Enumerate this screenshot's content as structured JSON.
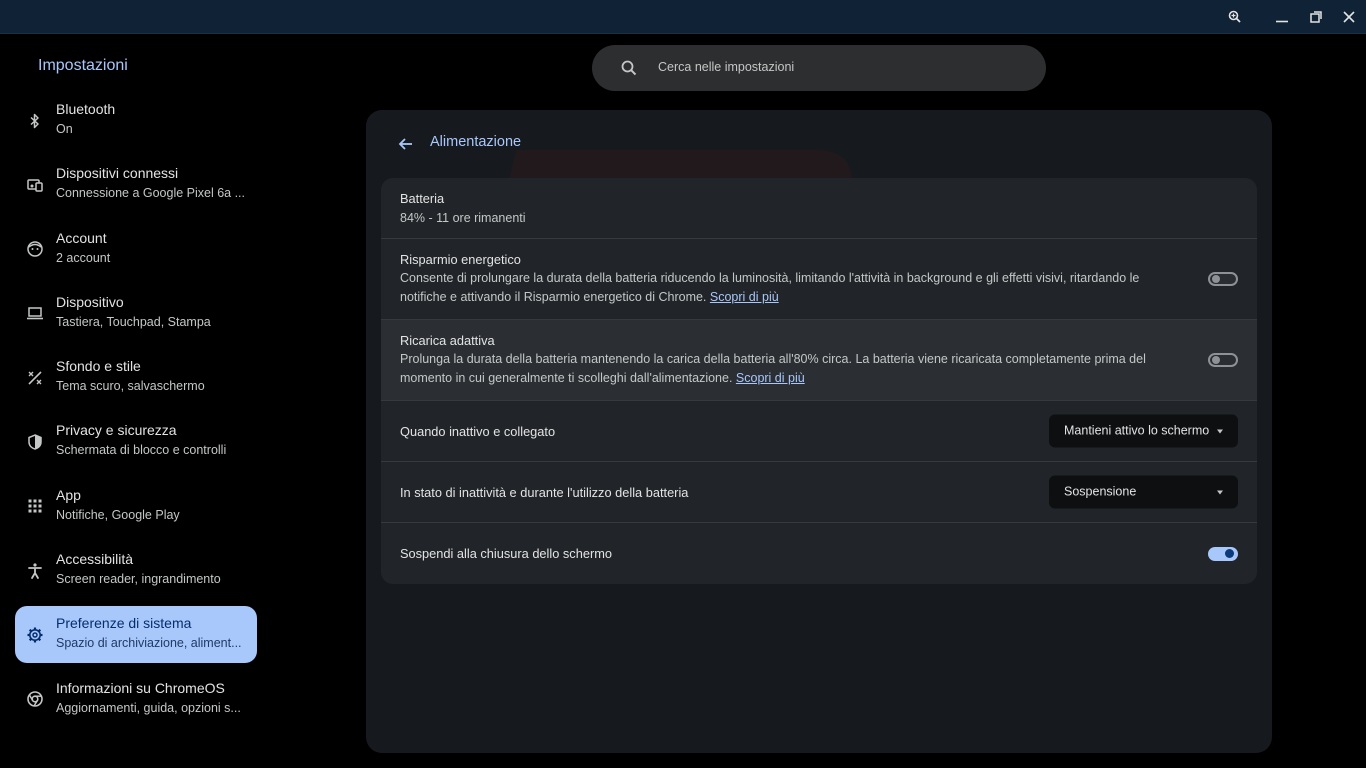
{
  "window": {
    "controls": [
      "zoom-icon",
      "minimize-icon",
      "restore-icon",
      "close-icon"
    ]
  },
  "app": {
    "title": "Impostazioni"
  },
  "search": {
    "placeholder": "Cerca nelle impostazioni"
  },
  "sidebar": {
    "items": [
      {
        "label": "Bluetooth",
        "sub": "On",
        "icon": "bluetooth-icon"
      },
      {
        "label": "Dispositivi connessi",
        "sub": "Connessione a Google Pixel 6a ...",
        "icon": "connected-devices-icon"
      },
      {
        "label": "Account",
        "sub": "2 account",
        "icon": "account-icon"
      },
      {
        "label": "Dispositivo",
        "sub": "Tastiera, Touchpad, Stampa",
        "icon": "laptop-icon"
      },
      {
        "label": "Sfondo e stile",
        "sub": "Tema scuro, salvaschermo",
        "icon": "palette-icon"
      },
      {
        "label": "Privacy e sicurezza",
        "sub": "Schermata di blocco e controlli",
        "icon": "shield-icon"
      },
      {
        "label": "App",
        "sub": "Notifiche, Google Play",
        "icon": "apps-grid-icon"
      },
      {
        "label": "Accessibilità",
        "sub": "Screen reader, ingrandimento",
        "icon": "accessibility-icon"
      },
      {
        "label": "Preferenze di sistema",
        "sub": "Spazio di archiviazione, aliment...",
        "icon": "gear-icon",
        "active": true
      },
      {
        "label": "Informazioni su ChromeOS",
        "sub": "Aggiornamenti, guida, opzioni s...",
        "icon": "chromeos-icon"
      }
    ]
  },
  "page": {
    "title": "Alimentazione",
    "battery": {
      "title": "Batteria",
      "status": "84% - 11 ore rimanenti"
    },
    "battery_saver": {
      "title": "Risparmio energetico",
      "desc": "Consente di prolungare la durata della batteria riducendo la luminosità, limitando l'attività in background e gli effetti visivi, ritardando le notifiche e attivando il Risparmio energetico di Chrome. ",
      "link": "Scopri di più",
      "enabled": false
    },
    "adaptive_charging": {
      "title": "Ricarica adattiva",
      "desc": "Prolunga la durata della batteria mantenendo la carica della batteria all'80% circa. La batteria viene ricaricata completamente prima del momento in cui generalmente ti scolleghi dall'alimentazione. ",
      "link": "Scopri di più",
      "enabled": false
    },
    "idle_plugged": {
      "title": "Quando inattivo e collegato",
      "value": "Mantieni attivo lo schermo"
    },
    "idle_battery": {
      "title": "In stato di inattività e durante l'utilizzo della batteria",
      "value": "Sospensione"
    },
    "sleep_on_lid": {
      "title": "Sospendi alla chiusura dello schermo",
      "enabled": true
    }
  },
  "colors": {
    "accent": "#a8c7fa",
    "titlebar": "#0f2236",
    "card": "#161a1f",
    "row_bg": "#212529"
  }
}
